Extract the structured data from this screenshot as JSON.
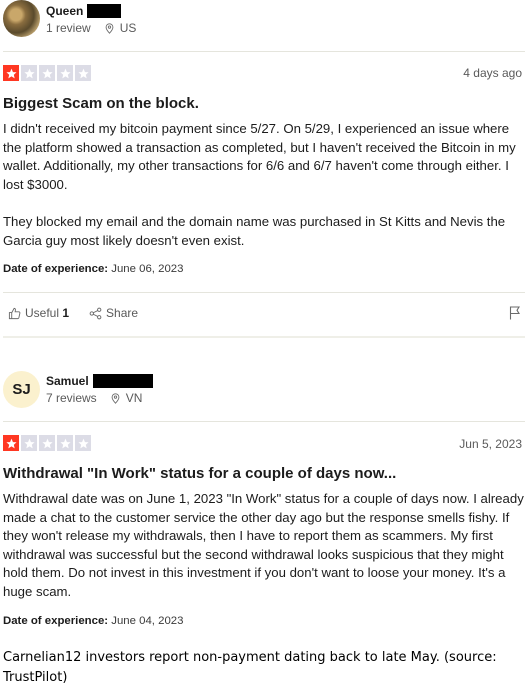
{
  "reviews": [
    {
      "reviewer_name": "Queen",
      "review_count": "1 review",
      "country": "US",
      "rating": 1,
      "date": "4 days ago",
      "title": "Biggest Scam on the block.",
      "body": "I didn't received my bitcoin payment since 5/27. On 5/29, I experienced an issue where the platform showed a transaction as completed, but I haven't received the Bitcoin in my wallet. Additionally, my other transactions for 6/6 and 6/7 haven't come through either. I lost $3000.\n\nThey blocked my email and the domain name was purchased in St Kitts and Nevis the Garcia guy most likely doesn't even exist.",
      "experience_label": "Date of experience:",
      "experience_date": "June 06, 2023",
      "useful_label": "Useful",
      "useful_count": "1",
      "share_label": "Share"
    },
    {
      "reviewer_name": "Samuel",
      "initials": "SJ",
      "review_count": "7 reviews",
      "country": "VN",
      "rating": 1,
      "date": "Jun 5, 2023",
      "title": "Withdrawal \"In Work\" status for a couple of days now...",
      "body": "Withdrawal date was on June 1, 2023 \"In Work\" status for a couple of days now. I already made a chat to the customer service the other day ago but the response smells fishy. If they won't release my withdrawals, then I have to report them as scammers. My first withdrawal was successful but the second withdrawal looks suspicious that they might hold them. Do not invest in this investment if you don't want to loose your money. It's a huge scam.",
      "experience_label": "Date of experience:",
      "experience_date": "June 04, 2023"
    }
  ],
  "caption": "Carnelian12 investors report non-payment dating back to late May. (source: TrustPilot)",
  "colors": {
    "star_on": "#ff3722",
    "star_off": "#dcdce6",
    "avatar_initials_bg": "#fbf1ce"
  }
}
